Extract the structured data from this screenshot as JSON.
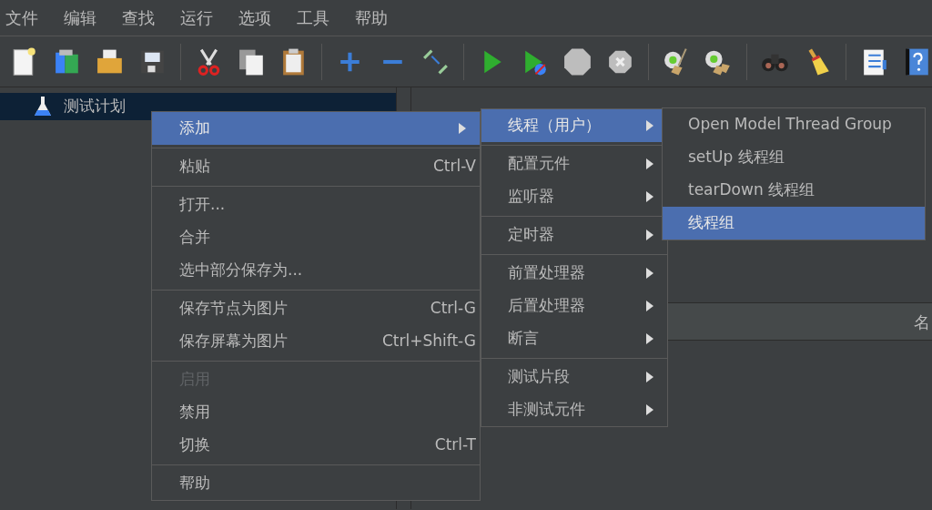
{
  "menubar": [
    "文件",
    "编辑",
    "查找",
    "运行",
    "选项",
    "工具",
    "帮助"
  ],
  "tree": [
    {
      "label": "测试计划",
      "selected": true
    }
  ],
  "table_header": {
    "column_1": "名"
  },
  "context_menu": {
    "groups": [
      [
        {
          "label": "添加",
          "selected": true,
          "disabled": false,
          "submenu": true
        }
      ],
      [
        {
          "label": "粘贴",
          "shortcut": "Ctrl-V",
          "selected": false,
          "disabled": false,
          "submenu": false
        }
      ],
      [
        {
          "label": "打开...",
          "selected": false,
          "disabled": false,
          "submenu": false
        },
        {
          "label": "合并",
          "selected": false,
          "disabled": false,
          "submenu": false
        },
        {
          "label": "选中部分保存为...",
          "selected": false,
          "disabled": false,
          "submenu": false
        }
      ],
      [
        {
          "label": "保存节点为图片",
          "shortcut": "Ctrl-G",
          "selected": false,
          "disabled": false,
          "submenu": false
        },
        {
          "label": "保存屏幕为图片",
          "shortcut": "Ctrl+Shift-G",
          "selected": false,
          "disabled": false,
          "submenu": false
        }
      ],
      [
        {
          "label": "启用",
          "selected": false,
          "disabled": true,
          "submenu": false
        },
        {
          "label": "禁用",
          "selected": false,
          "disabled": false,
          "submenu": false
        },
        {
          "label": "切换",
          "shortcut": "Ctrl-T",
          "selected": false,
          "disabled": false,
          "submenu": false
        }
      ],
      [
        {
          "label": "帮助",
          "selected": false,
          "disabled": false,
          "submenu": false
        }
      ]
    ]
  },
  "add_submenu": {
    "groups": [
      [
        {
          "label": "线程（用户）",
          "selected": true,
          "disabled": false,
          "submenu": true
        }
      ],
      [
        {
          "label": "配置元件",
          "selected": false,
          "disabled": false,
          "submenu": true
        },
        {
          "label": "监听器",
          "selected": false,
          "disabled": false,
          "submenu": true
        }
      ],
      [
        {
          "label": "定时器",
          "selected": false,
          "disabled": false,
          "submenu": true
        }
      ],
      [
        {
          "label": "前置处理器",
          "selected": false,
          "disabled": false,
          "submenu": true
        },
        {
          "label": "后置处理器",
          "selected": false,
          "disabled": false,
          "submenu": true
        },
        {
          "label": "断言",
          "selected": false,
          "disabled": false,
          "submenu": true
        }
      ],
      [
        {
          "label": "测试片段",
          "selected": false,
          "disabled": false,
          "submenu": true
        },
        {
          "label": "非测试元件",
          "selected": false,
          "disabled": false,
          "submenu": true
        }
      ]
    ]
  },
  "threads_submenu": {
    "groups": [
      [
        {
          "label": "Open Model Thread Group",
          "selected": false,
          "disabled": false,
          "submenu": false
        },
        {
          "label": "setUp 线程组",
          "selected": false,
          "disabled": false,
          "submenu": false
        },
        {
          "label": "tearDown 线程组",
          "selected": false,
          "disabled": false,
          "submenu": false
        },
        {
          "label": "线程组",
          "selected": true,
          "disabled": false,
          "submenu": false
        }
      ]
    ]
  }
}
